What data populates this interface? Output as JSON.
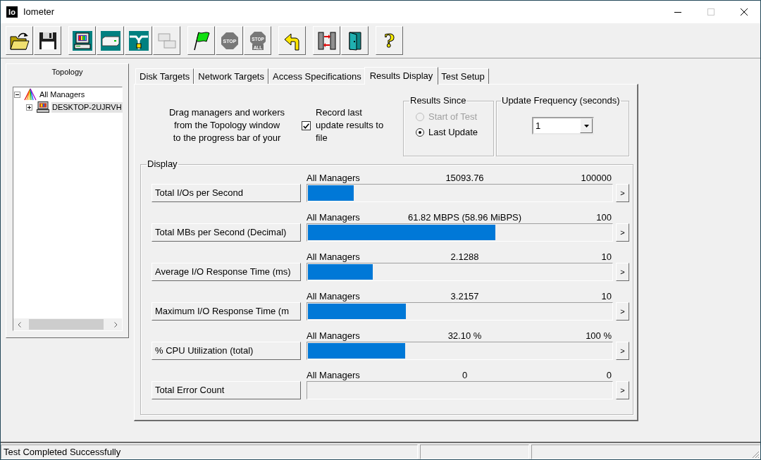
{
  "window": {
    "logo": "Io",
    "title": "Iometer",
    "controls": [
      {
        "kind": "minimize",
        "disabled": false
      },
      {
        "kind": "maximize",
        "disabled": true
      },
      {
        "kind": "close",
        "disabled": false
      }
    ]
  },
  "toolbar": {
    "groups": [
      [
        {
          "kind": "open",
          "disabled": false
        },
        {
          "kind": "save",
          "disabled": false
        }
      ],
      [
        {
          "kind": "manager",
          "disabled": false
        },
        {
          "kind": "disk_worker",
          "disabled": false
        },
        {
          "kind": "network_worker",
          "disabled": false
        },
        {
          "kind": "disconnect",
          "disabled": true
        }
      ],
      [
        {
          "kind": "start",
          "disabled": false
        },
        {
          "kind": "stop",
          "disabled": true,
          "text": "STOP"
        },
        {
          "kind": "stop_all",
          "disabled": true,
          "text": "STOP",
          "subtext": "ALL"
        }
      ],
      [
        {
          "kind": "reset",
          "disabled": false
        }
      ],
      [
        {
          "kind": "workers",
          "disabled": false
        },
        {
          "kind": "exit",
          "disabled": false
        }
      ],
      [
        {
          "kind": "help",
          "disabled": false,
          "text": "?"
        }
      ]
    ]
  },
  "topology": {
    "title": "Topology",
    "tree": [
      {
        "label": "All Managers",
        "expanded": true,
        "selected": false,
        "children": [
          {
            "label": "DESKTOP-2UJRVH",
            "expanded": false,
            "selected": true
          }
        ]
      }
    ]
  },
  "tabs": [
    {
      "label": "Disk Targets",
      "selected": false
    },
    {
      "label": "Network Targets",
      "selected": false
    },
    {
      "label": "Access Specifications",
      "selected": false
    },
    {
      "label": "Results Display",
      "selected": true
    },
    {
      "label": "Test Setup",
      "selected": false
    }
  ],
  "results_display": {
    "instructions": [
      "Drag managers and workers",
      "from the Topology window",
      "to the progress bar of your"
    ],
    "record": {
      "label": "Record last update results to file",
      "checked": true
    },
    "results_since": {
      "title": "Results Since",
      "options": [
        {
          "label": "Start of Test",
          "selected": false,
          "disabled": true
        },
        {
          "label": "Last Update",
          "selected": true,
          "disabled": false
        }
      ]
    },
    "update_frequency": {
      "title": "Update Frequency (seconds)",
      "value": "1"
    },
    "display": {
      "title": "Display",
      "rows": [
        {
          "metric": "Total I/Os per Second",
          "scope": "All Managers",
          "reading": "15093.76",
          "max": "100000",
          "level": 0.151,
          "more": ">"
        },
        {
          "metric": "Total MBs per Second (Decimal)",
          "scope": "All Managers",
          "reading": "61.82 MBPS (58.96 MiBPS)",
          "max": "100",
          "level": 0.618,
          "more": ">"
        },
        {
          "metric": "Average I/O Response Time (ms)",
          "scope": "All Managers",
          "reading": "2.1288",
          "max": "10",
          "level": 0.213,
          "more": ">"
        },
        {
          "metric": "Maximum I/O Response Time (m",
          "scope": "All Managers",
          "reading": "3.2157",
          "max": "10",
          "level": 0.322,
          "more": ">"
        },
        {
          "metric": "% CPU Utilization (total)",
          "scope": "All Managers",
          "reading": "32.10 %",
          "max": "100 %",
          "level": 0.321,
          "more": ">"
        },
        {
          "metric": "Total Error Count",
          "scope": "All Managers",
          "reading": "0",
          "max": "0",
          "more": ">"
        }
      ]
    }
  },
  "status_bar": {
    "text": "Test Completed Successfully"
  }
}
